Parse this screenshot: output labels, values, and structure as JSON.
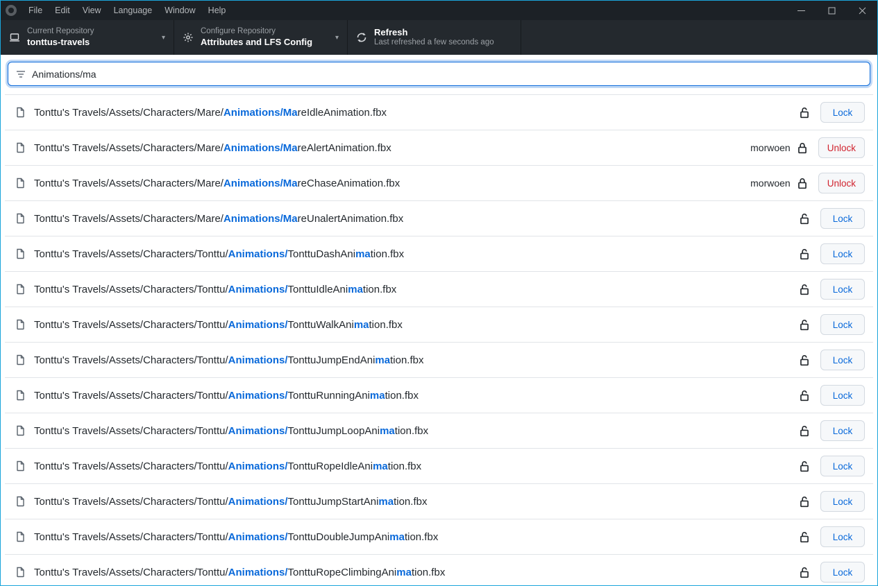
{
  "menubar": {
    "items": [
      "File",
      "Edit",
      "View",
      "Language",
      "Window",
      "Help"
    ]
  },
  "toolbar": {
    "repo": {
      "label": "Current Repository",
      "value": "tonttus-travels"
    },
    "configure": {
      "label": "Configure Repository",
      "value": "Attributes and LFS Config"
    },
    "refresh": {
      "label": "Refresh",
      "value": "Last refreshed a few seconds ago"
    }
  },
  "filter": {
    "value": "Animations/ma"
  },
  "labels": {
    "lock": "Lock",
    "unlock": "Unlock"
  },
  "rows": [
    {
      "segments": [
        "Tonttu's Travels/Assets/Characters/Mare/",
        "Animations/Ma",
        "reIdleAnimation.fbx"
      ],
      "locked": false,
      "owner": null
    },
    {
      "segments": [
        "Tonttu's Travels/Assets/Characters/Mare/",
        "Animations/Ma",
        "reAlertAnimation.fbx"
      ],
      "locked": true,
      "owner": "morwoen"
    },
    {
      "segments": [
        "Tonttu's Travels/Assets/Characters/Mare/",
        "Animations/Ma",
        "reChaseAnimation.fbx"
      ],
      "locked": true,
      "owner": "morwoen"
    },
    {
      "segments": [
        "Tonttu's Travels/Assets/Characters/Mare/",
        "Animations/Ma",
        "reUnalertAnimation.fbx"
      ],
      "locked": false,
      "owner": null
    },
    {
      "segments": [
        "Tonttu's Travels/Assets/Characters/Tonttu/",
        "Animations/",
        "TonttuDashAni",
        "ma",
        "tion.fbx"
      ],
      "locked": false,
      "owner": null
    },
    {
      "segments": [
        "Tonttu's Travels/Assets/Characters/Tonttu/",
        "Animations/",
        "TonttuIdleAni",
        "ma",
        "tion.fbx"
      ],
      "locked": false,
      "owner": null
    },
    {
      "segments": [
        "Tonttu's Travels/Assets/Characters/Tonttu/",
        "Animations/",
        "TonttuWalkAni",
        "ma",
        "tion.fbx"
      ],
      "locked": false,
      "owner": null
    },
    {
      "segments": [
        "Tonttu's Travels/Assets/Characters/Tonttu/",
        "Animations/",
        "TonttuJumpEndAni",
        "ma",
        "tion.fbx"
      ],
      "locked": false,
      "owner": null
    },
    {
      "segments": [
        "Tonttu's Travels/Assets/Characters/Tonttu/",
        "Animations/",
        "TonttuRunningAni",
        "ma",
        "tion.fbx"
      ],
      "locked": false,
      "owner": null
    },
    {
      "segments": [
        "Tonttu's Travels/Assets/Characters/Tonttu/",
        "Animations/",
        "TonttuJumpLoopAni",
        "ma",
        "tion.fbx"
      ],
      "locked": false,
      "owner": null
    },
    {
      "segments": [
        "Tonttu's Travels/Assets/Characters/Tonttu/",
        "Animations/",
        "TonttuRopeIdleAni",
        "ma",
        "tion.fbx"
      ],
      "locked": false,
      "owner": null
    },
    {
      "segments": [
        "Tonttu's Travels/Assets/Characters/Tonttu/",
        "Animations/",
        "TonttuJumpStartAni",
        "ma",
        "tion.fbx"
      ],
      "locked": false,
      "owner": null
    },
    {
      "segments": [
        "Tonttu's Travels/Assets/Characters/Tonttu/",
        "Animations/",
        "TonttuDoubleJumpAni",
        "ma",
        "tion.fbx"
      ],
      "locked": false,
      "owner": null
    },
    {
      "segments": [
        "Tonttu's Travels/Assets/Characters/Tonttu/",
        "Animations/",
        "TonttuRopeClimbingAni",
        "ma",
        "tion.fbx"
      ],
      "locked": false,
      "owner": null
    }
  ]
}
